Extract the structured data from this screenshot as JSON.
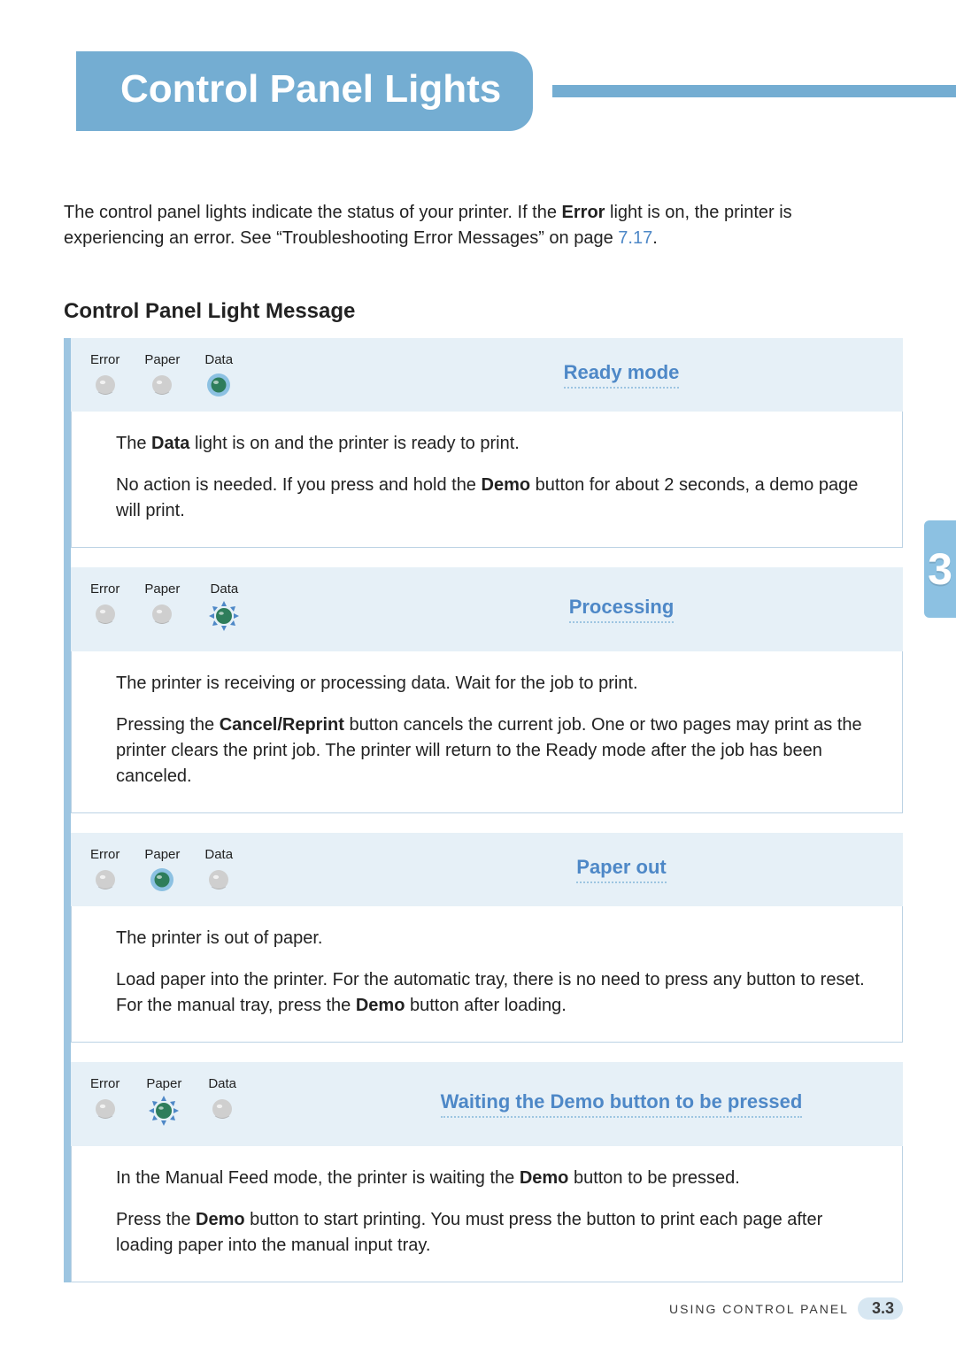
{
  "heading": "Control Panel Lights",
  "intro": {
    "part1": "The control panel lights indicate the status of your printer. If the ",
    "boldWord": "Error",
    "part2": " light is on, the printer is experiencing an error. See “Troubleshooting Error Messages” on page ",
    "link": "7.17",
    "part3": "."
  },
  "subheading": "Control Panel Light Message",
  "lightsLabels": {
    "error": "Error",
    "paper": "Paper",
    "data": "Data"
  },
  "sections": [
    {
      "title": "Ready mode",
      "lights": {
        "error": "off",
        "paper": "off",
        "data": "on"
      },
      "body": [
        [
          {
            "text": "The "
          },
          {
            "text": "Data",
            "bold": true
          },
          {
            "text": " light is on and the printer is ready to print."
          }
        ],
        [
          {
            "text": "No action is needed. If you press and hold the "
          },
          {
            "text": "Demo",
            "bold": true
          },
          {
            "text": " button for about 2 seconds, a demo page will print."
          }
        ]
      ]
    },
    {
      "title": "Processing",
      "lights": {
        "error": "off",
        "paper": "off",
        "data": "blink"
      },
      "body": [
        [
          {
            "text": "The printer is receiving or processing data. Wait for the job to print."
          }
        ],
        [
          {
            "text": "Pressing the "
          },
          {
            "text": "Cancel/Reprint",
            "bold": true
          },
          {
            "text": " button cancels the current job. One or two pages may print as the printer clears the print job. The printer will return to the Ready mode after the job has been canceled."
          }
        ]
      ]
    },
    {
      "title": "Paper out",
      "lights": {
        "error": "off",
        "paper": "on",
        "data": "off"
      },
      "body": [
        [
          {
            "text": "The printer is out of paper."
          }
        ],
        [
          {
            "text": "Load paper into the printer. For the automatic tray, there is no need to press any button to reset. For the manual tray, press the "
          },
          {
            "text": "Demo",
            "bold": true
          },
          {
            "text": " button after loading."
          }
        ]
      ]
    },
    {
      "title": "Waiting the Demo button to be pressed",
      "lights": {
        "error": "off",
        "paper": "blink",
        "data": "off"
      },
      "body": [
        [
          {
            "text": "In the Manual Feed mode, the printer is waiting the "
          },
          {
            "text": "Demo",
            "bold": true
          },
          {
            "text": " button to be pressed."
          }
        ],
        [
          {
            "text": "Press the "
          },
          {
            "text": "Demo",
            "bold": true
          },
          {
            "text": " button to start printing. You must press the button to print each page after loading paper into the manual input tray."
          }
        ]
      ]
    }
  ],
  "sideTab": "3",
  "footer": {
    "text": "USING CONTROL PANEL",
    "page": "3.3"
  },
  "colors": {
    "offFill": "#cfcfcf",
    "onFill": "#2e7d5b",
    "onRing": "#8cc1e2",
    "blinkArrow": "#4e88c7"
  }
}
